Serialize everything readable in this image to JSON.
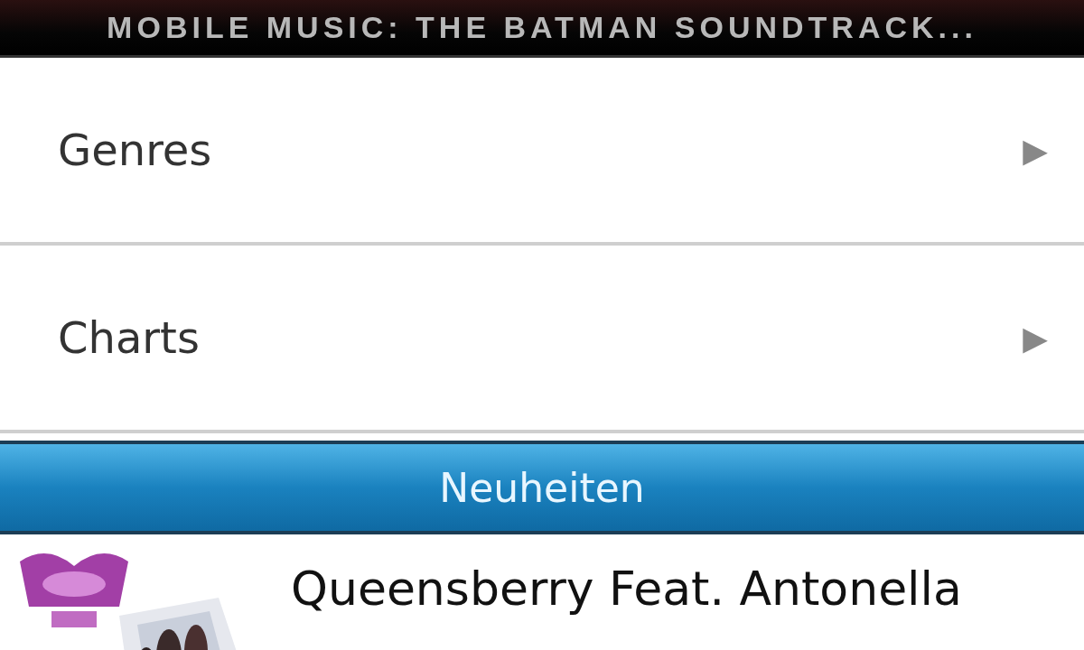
{
  "banner": {
    "title": "MOBILE MUSIC: THE BATMAN SOUNDTRACK..."
  },
  "menu": [
    {
      "label": "Genres",
      "arrow": "▶"
    },
    {
      "label": "Charts",
      "arrow": "▶"
    }
  ],
  "section": {
    "title": "Neuheiten"
  },
  "tracks": [
    {
      "artist": "Queensberry Feat. Antonella"
    }
  ]
}
